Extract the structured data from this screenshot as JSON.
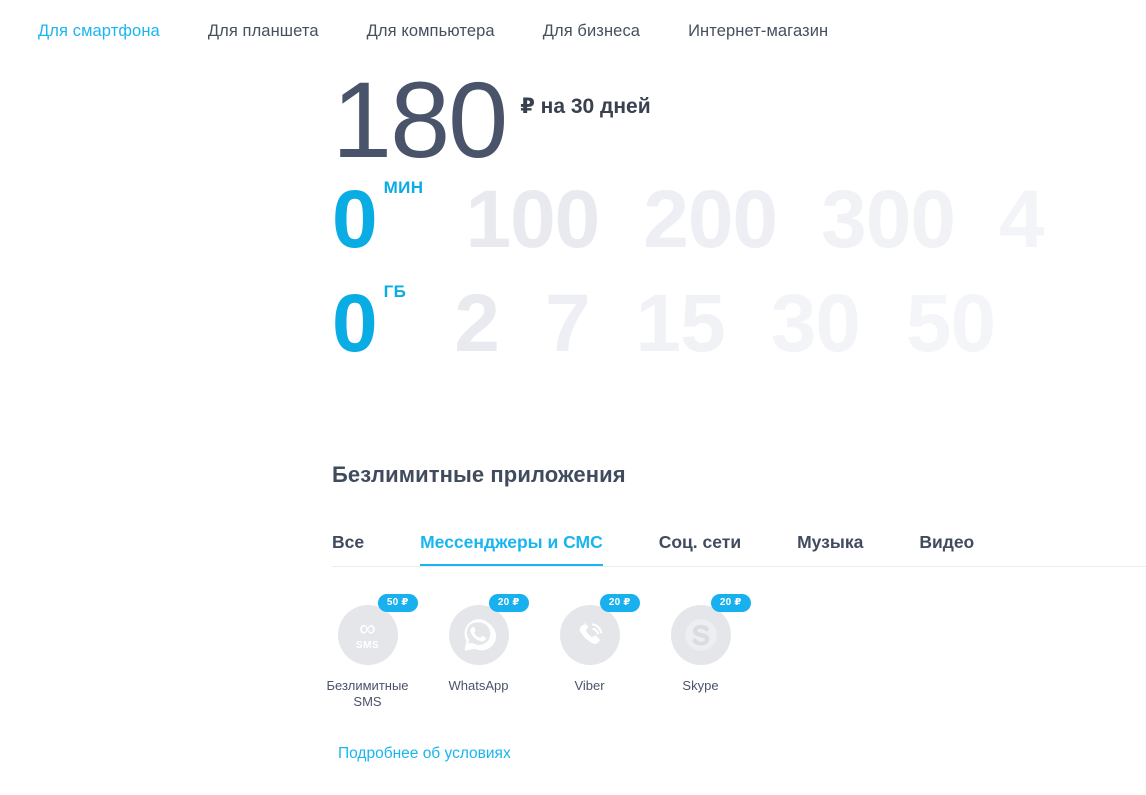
{
  "nav": {
    "items": [
      {
        "label": "Для смартфона",
        "active": true
      },
      {
        "label": "Для планшета",
        "active": false
      },
      {
        "label": "Для компьютера",
        "active": false
      },
      {
        "label": "Для бизнеса",
        "active": false
      },
      {
        "label": "Интернет-магазин",
        "active": false
      }
    ]
  },
  "price": {
    "value": "180",
    "suffix": "₽ на 30 дней"
  },
  "sliders": {
    "minutes": {
      "unit": "мин",
      "selected": "0",
      "options": [
        "0",
        "100",
        "200",
        "300",
        "4"
      ]
    },
    "data": {
      "unit": "ГБ",
      "selected": "0",
      "options": [
        "0",
        "2",
        "7",
        "15",
        "30",
        "50"
      ]
    }
  },
  "apps_section": {
    "title": "Безлимитные приложения",
    "tabs": [
      {
        "label": "Все",
        "active": false
      },
      {
        "label": "Мессенджеры и СМС",
        "active": true
      },
      {
        "label": "Соц. сети",
        "active": false
      },
      {
        "label": "Музыка",
        "active": false
      },
      {
        "label": "Видео",
        "active": false
      }
    ],
    "apps": [
      {
        "name": "Безлимитные\nSMS",
        "price": "50 ₽",
        "icon": "infinity-sms-icon"
      },
      {
        "name": "WhatsApp",
        "price": "20 ₽",
        "icon": "whatsapp-icon"
      },
      {
        "name": "Viber",
        "price": "20 ₽",
        "icon": "viber-icon"
      },
      {
        "name": "Skype",
        "price": "20 ₽",
        "icon": "skype-icon"
      }
    ],
    "more_link": "Подробнее об условиях"
  },
  "colors": {
    "accent": "#19b5f0",
    "accent_slider": "#0aace4",
    "text_dark": "#414b5e",
    "price_text": "#49536a",
    "circle_bg": "#e4e6ea",
    "badge_bg": "#19b0ef"
  }
}
